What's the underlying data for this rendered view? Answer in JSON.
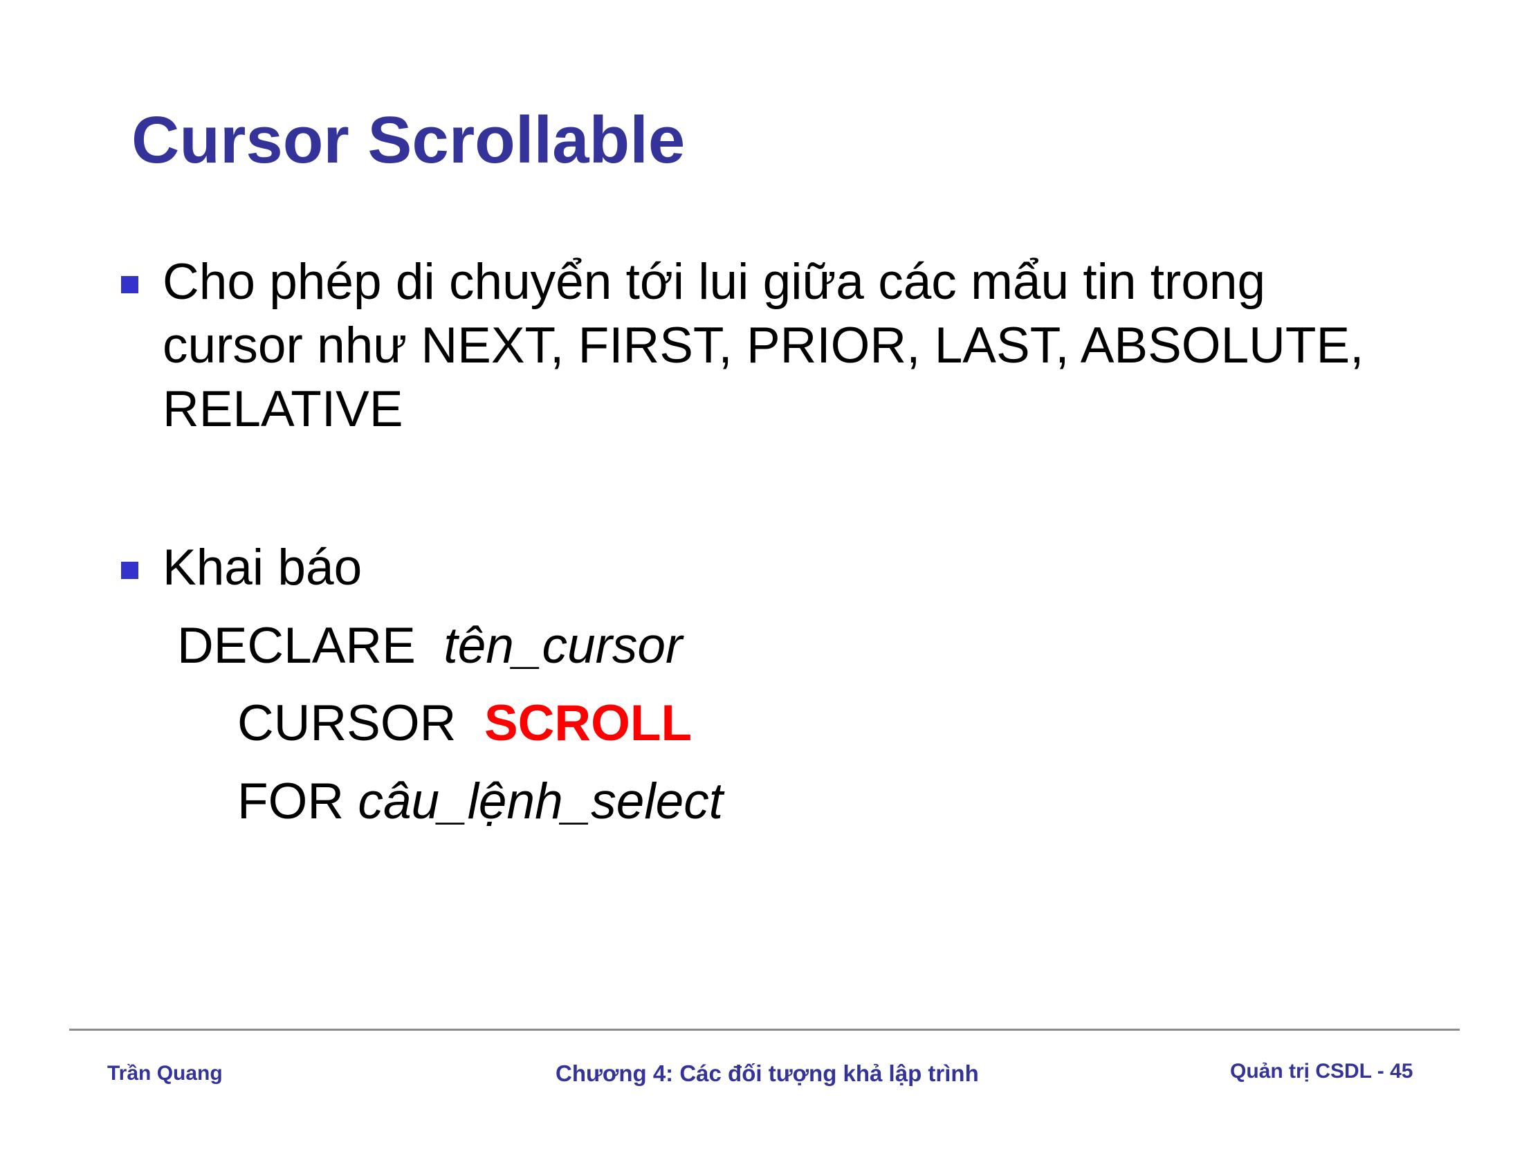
{
  "slide": {
    "title": "Cursor Scrollable",
    "bullets": [
      {
        "text": "Cho phép di chuyển tới lui giữa các mẩu tin trong cursor như NEXT, FIRST, PRIOR, LAST, ABSOLUTE, RELATIVE"
      },
      {
        "text": "Khai báo"
      }
    ],
    "code": {
      "line1_keyword": "DECLARE",
      "line1_param": "tên_cursor",
      "line2_keyword": "CURSOR",
      "line2_highlight": "SCROLL",
      "line3_keyword": "FOR",
      "line3_param": "câu_lệnh_select"
    }
  },
  "footer": {
    "author": "Trần Quang",
    "chapter": "Chương 4: Các đối tượng khả lập trình",
    "page": "Quản trị CSDL - 45"
  },
  "colors": {
    "title": "#333399",
    "bullet_marker": "#3333cc",
    "highlight": "#ff0000",
    "footer": "#333399",
    "rule": "#8c8c8c"
  }
}
